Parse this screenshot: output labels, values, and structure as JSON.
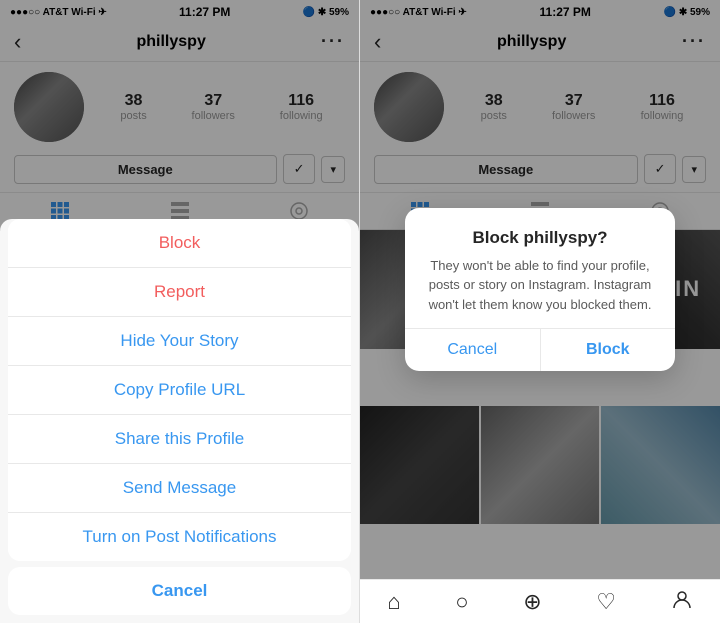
{
  "left": {
    "statusBar": {
      "signal": "●●●○○ AT&T Wi-Fi ✈",
      "time": "11:27 PM",
      "icons": "🔵 * 59%"
    },
    "nav": {
      "backLabel": "‹",
      "title": "phillyspy",
      "moreLabel": "···"
    },
    "profile": {
      "stats": [
        {
          "num": "38",
          "label": "posts"
        },
        {
          "num": "37",
          "label": "followers"
        },
        {
          "num": "116",
          "label": "following"
        }
      ],
      "messageBtn": "Message",
      "followCheckBtn": "✓",
      "dropdownBtn": "▼"
    },
    "actionSheet": {
      "items": [
        {
          "label": "Block",
          "style": "red"
        },
        {
          "label": "Report",
          "style": "red"
        },
        {
          "label": "Hide Your Story",
          "style": "blue"
        },
        {
          "label": "Copy Profile URL",
          "style": "blue"
        },
        {
          "label": "Share this Profile",
          "style": "blue"
        },
        {
          "label": "Send Message",
          "style": "blue"
        },
        {
          "label": "Turn on Post Notifications",
          "style": "blue"
        }
      ],
      "cancelLabel": "Cancel"
    }
  },
  "right": {
    "statusBar": {
      "signal": "●●●○○ AT&T Wi-Fi ✈",
      "time": "11:27 PM",
      "icons": "🔵 * 59%"
    },
    "nav": {
      "backLabel": "‹",
      "title": "phillyspy",
      "moreLabel": "···"
    },
    "profile": {
      "stats": [
        {
          "num": "38",
          "label": "posts"
        },
        {
          "num": "37",
          "label": "followers"
        },
        {
          "num": "116",
          "label": "following"
        }
      ],
      "messageBtn": "Message",
      "followCheckBtn": "✓",
      "dropdownBtn": "▼"
    },
    "dialog": {
      "title": "Block phillyspy?",
      "body": "They won't be able to find your profile, posts or story on Instagram. Instagram won't let them know you blocked them.",
      "cancelLabel": "Cancel",
      "blockLabel": "Block"
    },
    "tabBar": {
      "icons": [
        "⌂",
        "○",
        "⊕",
        "♡",
        "👤"
      ]
    }
  }
}
